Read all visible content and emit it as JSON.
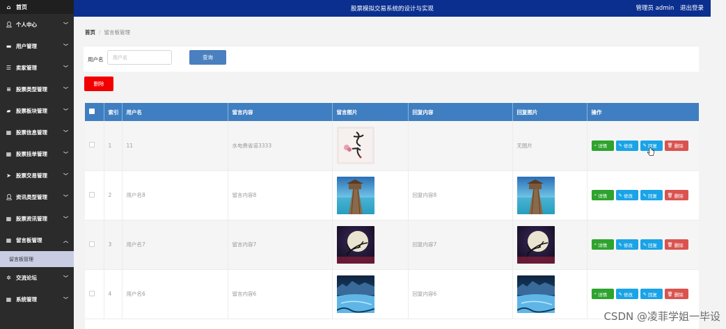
{
  "sidebar": {
    "home": {
      "label": "首页",
      "icon": "home-icon"
    },
    "items": [
      {
        "label": "个人中心",
        "icon": "user-icon"
      },
      {
        "label": "用户管理",
        "icon": "monitor-icon"
      },
      {
        "label": "卖家管理",
        "icon": "sliders-icon"
      },
      {
        "label": "股票类型管理",
        "icon": "list-icon"
      },
      {
        "label": "股票板块管理",
        "icon": "chat-icon"
      },
      {
        "label": "股票信息管理",
        "icon": "grid-icon"
      },
      {
        "label": "股票挂单管理",
        "icon": "grid-icon"
      },
      {
        "label": "股票交易管理",
        "icon": "send-icon"
      },
      {
        "label": "资讯类型管理",
        "icon": "user-icon"
      },
      {
        "label": "股票资讯管理",
        "icon": "grid-icon"
      },
      {
        "label": "留言板管理",
        "icon": "grid-icon",
        "expanded": true
      },
      {
        "label": "交流论坛",
        "icon": "gear-icon"
      },
      {
        "label": "系统管理",
        "icon": "grid-icon"
      }
    ],
    "submenu_active": "留言板管理"
  },
  "header": {
    "title": "股票模拟交易系统的设计与实现",
    "user": "管理员 admin",
    "logout": "退出登录"
  },
  "breadcrumb": {
    "home": "首页",
    "current": "留言板管理"
  },
  "search": {
    "label": "用户名",
    "placeholder": "用户名",
    "button": "查询"
  },
  "toolbar": {
    "delete_label": "删除"
  },
  "table": {
    "columns": [
      "索引",
      "用户名",
      "留言内容",
      "留言图片",
      "回复内容",
      "回复图片",
      "操作"
    ],
    "rows": [
      {
        "index": "1",
        "username": "11",
        "content": "水电费省道3333",
        "image": "calligraphy",
        "reply": "",
        "reply_image": "无图片"
      },
      {
        "index": "2",
        "username": "用户名8",
        "content": "留言内容8",
        "image": "pier",
        "reply": "回复内容8",
        "reply_image": "pier"
      },
      {
        "index": "3",
        "username": "用户名7",
        "content": "留言内容7",
        "image": "moon",
        "reply": "回复内容7",
        "reply_image": "moon"
      },
      {
        "index": "4",
        "username": "用户名6",
        "content": "留言内容6",
        "image": "river",
        "reply": "回复内容6",
        "reply_image": "river"
      }
    ],
    "actions": {
      "detail": "详情",
      "edit": "修改",
      "reply": "回复",
      "delete": "删除"
    }
  },
  "watermark": "CSDN @凌菲学姐一毕设",
  "colors": {
    "sidebar_bg": "#2b2b2b",
    "header_bg": "#0b2f8f",
    "table_header": "#3f7ec0",
    "btn_query": "#4a7fc0",
    "btn_delete": "#f20000",
    "op_detail": "#2ea32e",
    "op_edit": "#1aa3e6",
    "op_delete": "#d9534f"
  }
}
